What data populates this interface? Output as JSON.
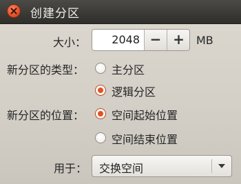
{
  "window": {
    "title": "创建分区"
  },
  "size": {
    "label": "大小：",
    "value": "2048",
    "decrement_label": "−",
    "increment_label": "+",
    "unit": "MB"
  },
  "partition_type": {
    "label": "新分区的类型：",
    "options": [
      {
        "label": "主分区",
        "checked": false
      },
      {
        "label": "逻辑分区",
        "checked": true
      }
    ]
  },
  "partition_location": {
    "label": "新分区的位置：",
    "options": [
      {
        "label": "空间起始位置",
        "checked": true
      },
      {
        "label": "空间结束位置",
        "checked": false
      }
    ]
  },
  "use_as": {
    "label": "用于：",
    "selected": "交换空间"
  },
  "icons": {
    "close": "close-icon",
    "dropdown": "chevron-down-icon"
  },
  "colors": {
    "titlebar": "#3a3935",
    "close_button": "#e6552c",
    "radio_selected": "#de5425"
  }
}
